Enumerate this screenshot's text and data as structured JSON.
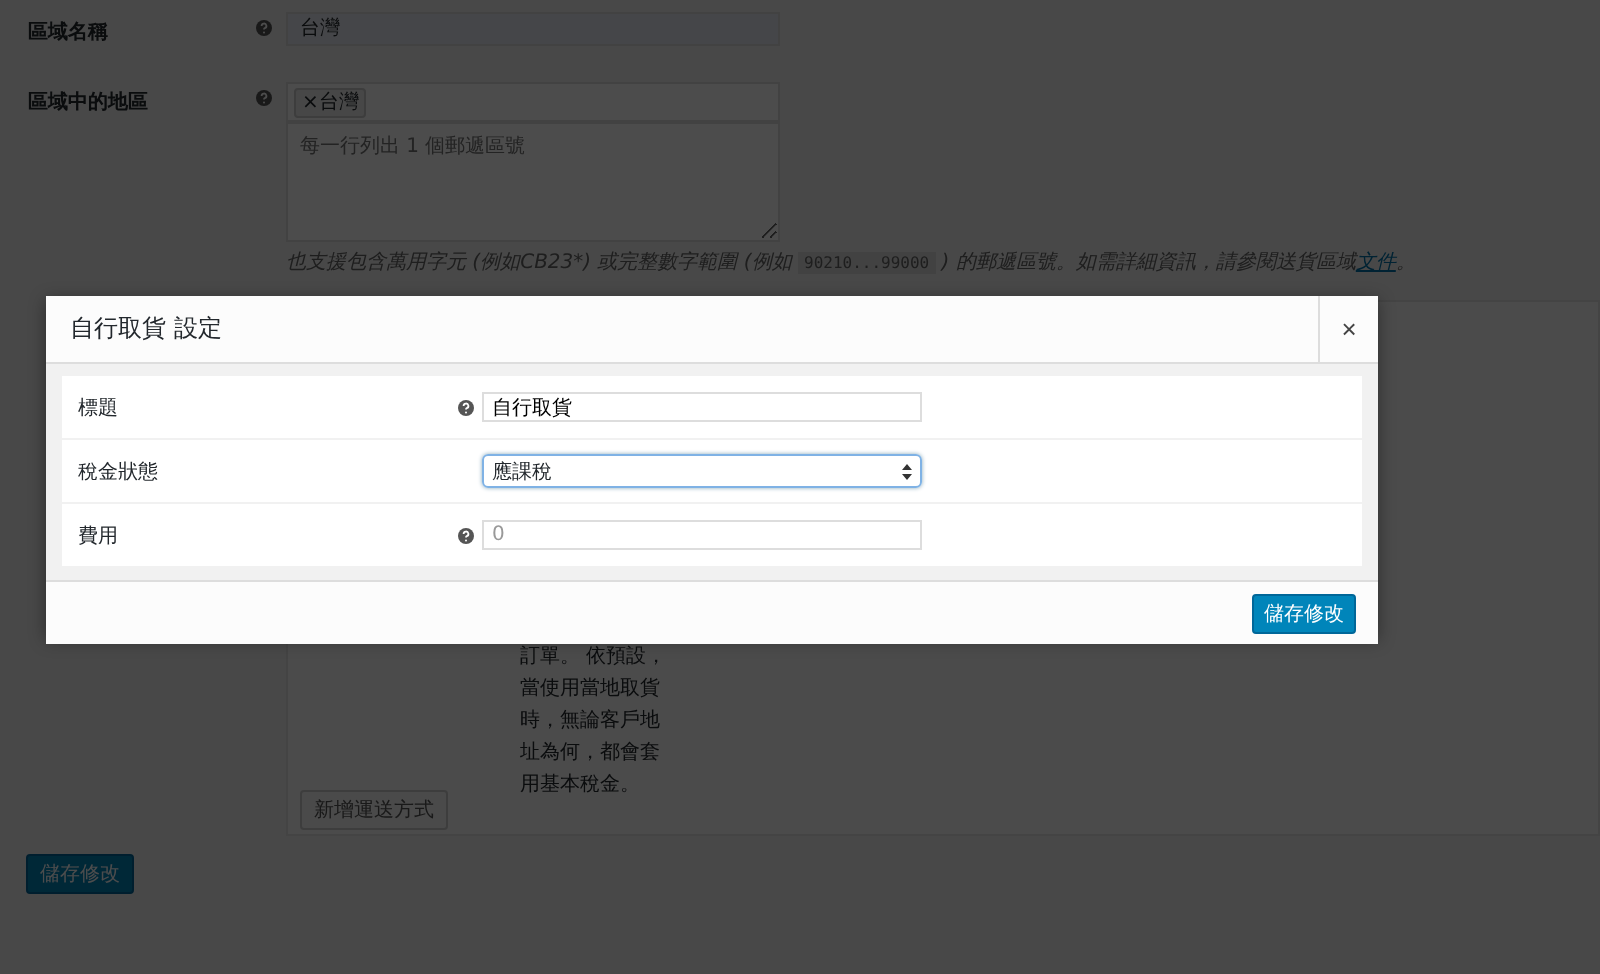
{
  "zone_form": {
    "rows": [
      {
        "kind": "input",
        "label": "區域名稱",
        "help": true,
        "value": "台灣"
      },
      {
        "kind": "regions",
        "label": "區域中的地區",
        "help": true,
        "tags": [
          "台灣"
        ],
        "tag_remove": "×",
        "placeholder": "每一行列出 1 個郵遞區號"
      }
    ],
    "note": {
      "before": "也支援包含萬用字元 (例如CB23*) 或完整數字範圍 (例如 ",
      "code": "90210...99000",
      "middle": " ) 的郵遞區號。如需詳細資訊，請參閱送貨區域",
      "link": "文件",
      "after": "。"
    }
  },
  "shipping_methods": {
    "description": "訂單。 依預設，當使用當地取貨時，無論客戶地址為何，都會套用基本稅金。",
    "add_button": "新增運送方式"
  },
  "save_button": "儲存修改",
  "modal": {
    "title": "自行取貨 設定",
    "close": "×",
    "fields": [
      {
        "kind": "text",
        "label": "標題",
        "help": true,
        "value": "自行取貨"
      },
      {
        "kind": "select",
        "label": "稅金狀態",
        "help": false,
        "value": "應課稅"
      },
      {
        "kind": "text",
        "label": "費用",
        "help": true,
        "placeholder": "0"
      }
    ],
    "save_button": "儲存修改"
  }
}
